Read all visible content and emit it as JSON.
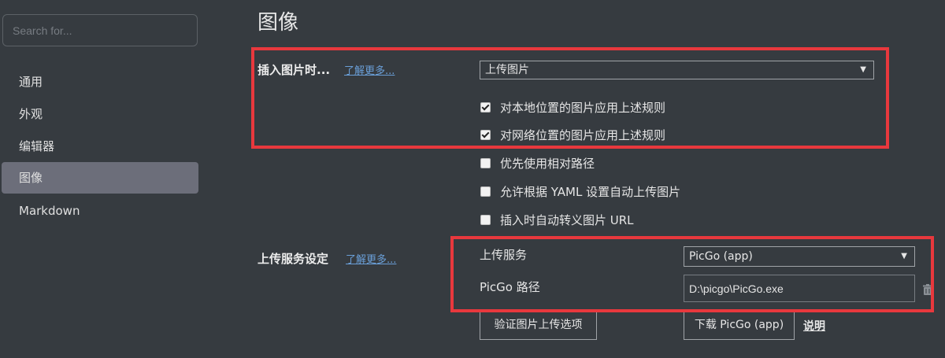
{
  "sidebar": {
    "search_placeholder": "Search for...",
    "items": [
      {
        "label": "通用"
      },
      {
        "label": "外观"
      },
      {
        "label": "编辑器"
      },
      {
        "label": "图像",
        "active": true
      },
      {
        "label": "Markdown"
      }
    ]
  },
  "main": {
    "title": "图像",
    "insert": {
      "label": "插入图片时...",
      "learn_more": "了解更多...",
      "select_value": "上传图片",
      "checkboxes": [
        {
          "label": "对本地位置的图片应用上述规则",
          "checked": true
        },
        {
          "label": "对网络位置的图片应用上述规则",
          "checked": true
        },
        {
          "label": "优先使用相对路径",
          "checked": false
        },
        {
          "label": "允许根据 YAML 设置自动上传图片",
          "checked": false
        },
        {
          "label": "插入时自动转义图片 URL",
          "checked": false
        }
      ]
    },
    "upload": {
      "label": "上传服务设定",
      "learn_more": "了解更多...",
      "service_label": "上传服务",
      "service_value": "PicGo (app)",
      "path_label": "PicGo 路径",
      "path_value": "D:\\picgo\\PicGo.exe",
      "verify_button": "验证图片上传选项",
      "download_button": "下载 PicGo (app)",
      "help_link": "说明"
    }
  },
  "colors": {
    "background": "#363b40",
    "active_nav": "#6c6e7a",
    "link": "#6a9fd8",
    "highlight_box": "#e8383d"
  }
}
